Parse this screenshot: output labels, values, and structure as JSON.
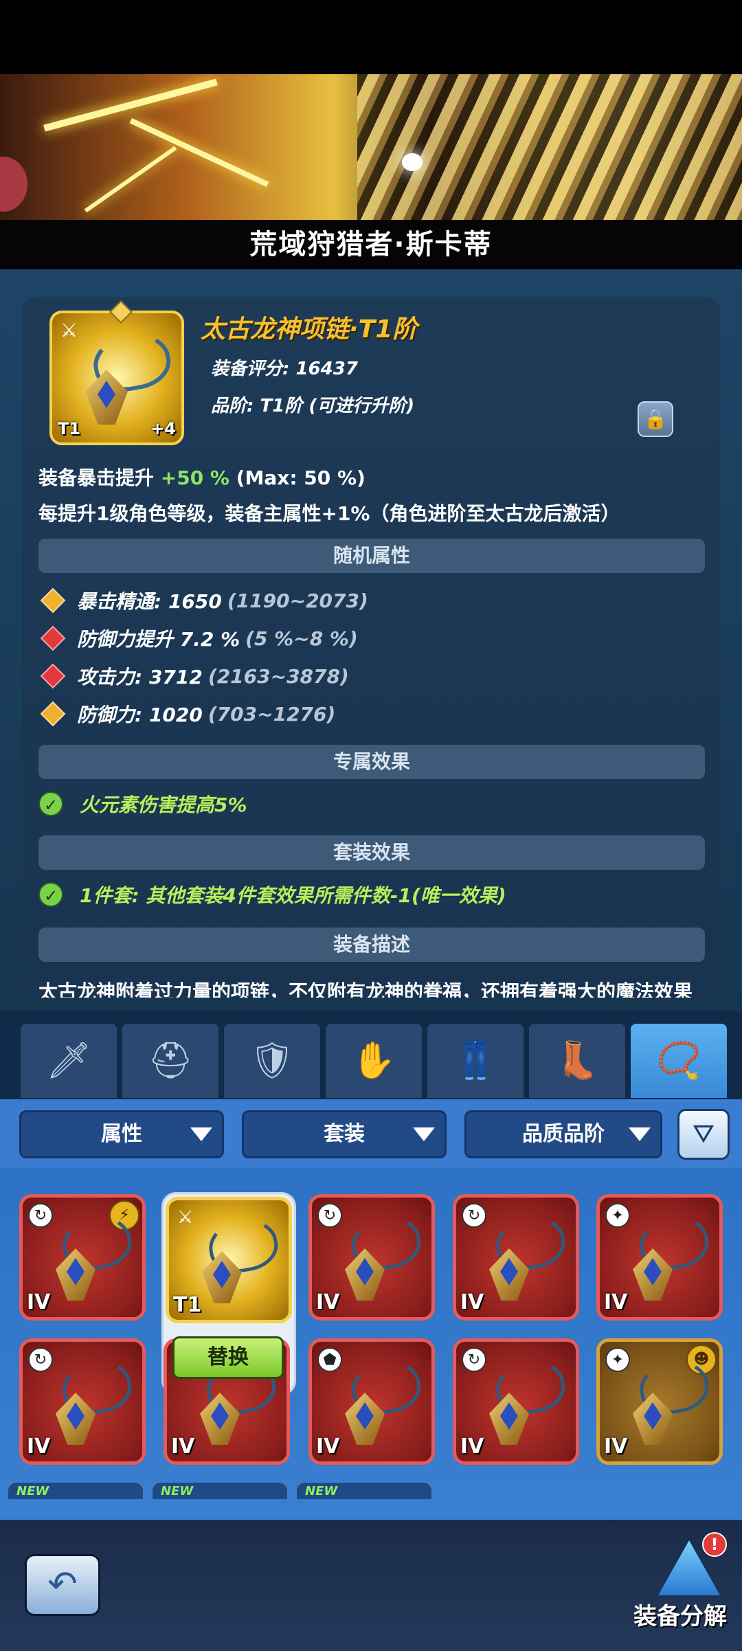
{
  "hero": {
    "title": "荒域狩猎者·斯卡蒂"
  },
  "equipment": {
    "name": "太古龙神项链·T1阶",
    "score": "装备评分: 16437",
    "grade": "品阶: T1阶 (可进行升阶)",
    "tier": "T1",
    "plus": "+4",
    "crit_prefix": "装备暴击提升 ",
    "crit_value": "+50 %",
    "crit_max": " (Max: 50 %)",
    "level_bonus": "每提升1级角色等级，装备主属性+1%（角色进阶至太古龙后激活）"
  },
  "sections": {
    "random": "随机属性",
    "exclusive": "专属效果",
    "set": "套装效果",
    "description": "装备描述"
  },
  "attributes": [
    {
      "label": "暴击精通: 1650",
      "range": "(1190~2073)",
      "color": "#f0b030"
    },
    {
      "label": "防御力提升 7.2 %",
      "range": "(5 %~8 %)",
      "color": "#e23a3a"
    },
    {
      "label": "攻击力: 3712",
      "range": "(2163~3878)",
      "color": "#e23a3a"
    },
    {
      "label": "防御力: 1020",
      "range": "(703~1276)",
      "color": "#f0b030"
    }
  ],
  "exclusive_effect": "火元素伤害提高5%",
  "set_effect": "1件套: 其他套装4件套效果所需件数-1(唯一效果)",
  "description_text": "太古龙神附着过力量的项链，不仅附有龙神的眷福，还拥有着强大的魔法效果",
  "tabs": [
    {
      "icon": "sword-icon",
      "glyph": "🗡"
    },
    {
      "icon": "helmet-icon",
      "glyph": "⛑"
    },
    {
      "icon": "armor-icon",
      "glyph": "🛡"
    },
    {
      "icon": "gauntlet-icon",
      "glyph": "✋"
    },
    {
      "icon": "pants-icon",
      "glyph": "👖"
    },
    {
      "icon": "boots-icon",
      "glyph": "👢"
    },
    {
      "icon": "necklace-icon",
      "glyph": "📿"
    }
  ],
  "filters": {
    "attribute": "属性",
    "set": "套装",
    "quality": "品质品阶"
  },
  "grid_level": "IV",
  "grid_tier": "T1",
  "replace_label": "替换",
  "new_tag": "NEW",
  "bottom": {
    "decompose": "装备分解",
    "alert": "!"
  }
}
